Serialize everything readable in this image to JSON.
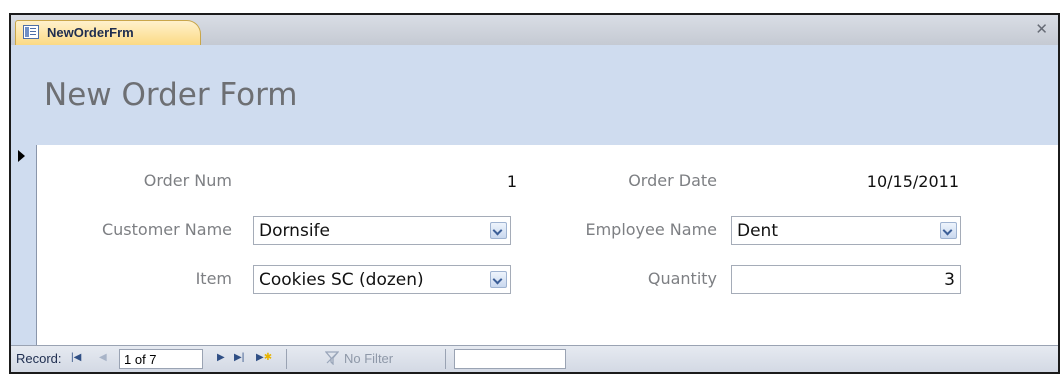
{
  "tab": {
    "title": "NewOrderFrm",
    "icon": "form-icon"
  },
  "form": {
    "title": "New Order Form"
  },
  "fields": {
    "order_num": {
      "label": "Order Num",
      "value": "1"
    },
    "order_date": {
      "label": "Order Date",
      "value": "10/15/2011"
    },
    "customer_name": {
      "label": "Customer Name",
      "value": "Dornsife"
    },
    "employee_name": {
      "label": "Employee Name",
      "value": "Dent"
    },
    "item": {
      "label": "Item",
      "value": "Cookies SC (dozen)"
    },
    "quantity": {
      "label": "Quantity",
      "value": "3"
    }
  },
  "navbar": {
    "record_label": "Record:",
    "position": "1 of 7",
    "no_filter_label": "No Filter",
    "search_value": ""
  },
  "colors": {
    "header_bg": "#cfdcef",
    "tab_bg": "#fbd981",
    "title_text": "#6d6f73",
    "label_text": "#7d7f83"
  }
}
